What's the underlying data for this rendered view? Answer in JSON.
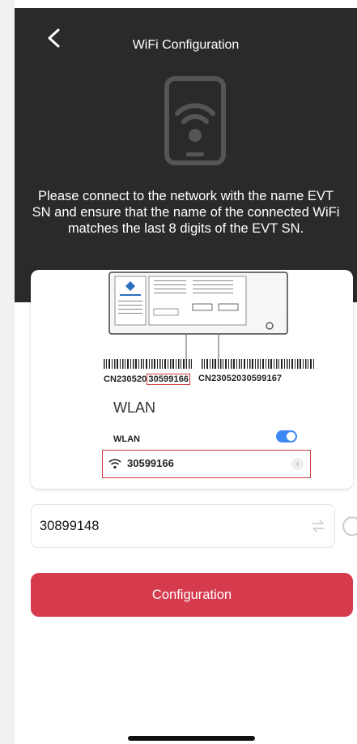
{
  "header": {
    "title": "WiFi Configuration",
    "instruction": "Please connect to the network with the name EVT SN and ensure that the name of the connected WiFi matches the last 8 digits of the EVT SN."
  },
  "example": {
    "sn1_prefix": "CN230520",
    "sn1_highlight": "30599166",
    "sn2": "CN230520305991​67",
    "wlan_title": "WLAN",
    "wlan_label": "WLAN",
    "network_name": "30599166"
  },
  "form": {
    "sn_value": "30899148"
  },
  "buttons": {
    "configuration": "Configuration"
  },
  "colors": {
    "header_bg": "#2a2a2a",
    "accent": "#d63a4d",
    "toggle": "#3b87f5",
    "highlight": "#d03a3a"
  }
}
